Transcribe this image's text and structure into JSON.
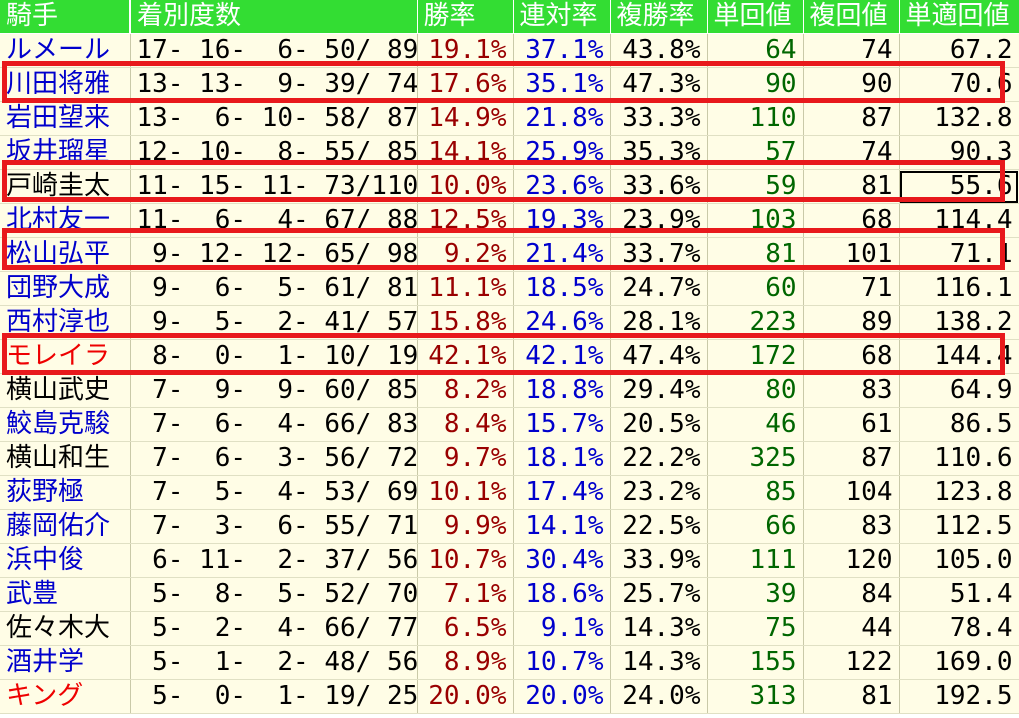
{
  "headers": [
    "騎手",
    "着別度数",
    "勝率",
    "連対率",
    "複勝率",
    "単回値",
    "複回値",
    "単適回値"
  ],
  "colors": {
    "header_bg": "#33dd33",
    "row_bg": "#fffde6",
    "name_blue": "#0000cc",
    "name_red": "#ee0000",
    "name_black": "#000000",
    "win_rate": "#990000",
    "place_rate": "#0000cc",
    "tan_value": "#006600",
    "highlight": "#e8191c"
  },
  "rows": [
    {
      "jockey": "ルメール",
      "name_color": "blue",
      "record": "17- 16-  6- 50/ 89",
      "win": "19.1%",
      "ren": "37.1%",
      "fuku": "43.8%",
      "tan": "64",
      "fukuk": "74",
      "tanteki": "67.2"
    },
    {
      "jockey": "川田将雅",
      "name_color": "blue",
      "record": "13- 13-  9- 39/ 74",
      "win": "17.6%",
      "ren": "35.1%",
      "fuku": "47.3%",
      "tan": "90",
      "fukuk": "90",
      "tanteki": "70.6"
    },
    {
      "jockey": "岩田望来",
      "name_color": "blue",
      "record": "13-  6- 10- 58/ 87",
      "win": "14.9%",
      "ren": "21.8%",
      "fuku": "33.3%",
      "tan": "110",
      "fukuk": "87",
      "tanteki": "132.8"
    },
    {
      "jockey": "坂井瑠星",
      "name_color": "blue",
      "record": "12- 10-  8- 55/ 85",
      "win": "14.1%",
      "ren": "25.9%",
      "fuku": "35.3%",
      "tan": "57",
      "fukuk": "74",
      "tanteki": "90.3"
    },
    {
      "jockey": "戸崎圭太",
      "name_color": "black",
      "record": "11- 15- 11- 73/110",
      "win": "10.0%",
      "ren": "23.6%",
      "fuku": "33.6%",
      "tan": "59",
      "fukuk": "81",
      "tanteki": "55.6"
    },
    {
      "jockey": "北村友一",
      "name_color": "blue",
      "record": "11-  6-  4- 67/ 88",
      "win": "12.5%",
      "ren": "19.3%",
      "fuku": "23.9%",
      "tan": "103",
      "fukuk": "68",
      "tanteki": "114.4"
    },
    {
      "jockey": "松山弘平",
      "name_color": "blue",
      "record": " 9- 12- 12- 65/ 98",
      "win": "9.2%",
      "ren": "21.4%",
      "fuku": "33.7%",
      "tan": "81",
      "fukuk": "101",
      "tanteki": "71.1"
    },
    {
      "jockey": "団野大成",
      "name_color": "blue",
      "record": " 9-  6-  5- 61/ 81",
      "win": "11.1%",
      "ren": "18.5%",
      "fuku": "24.7%",
      "tan": "60",
      "fukuk": "71",
      "tanteki": "116.1"
    },
    {
      "jockey": "西村淳也",
      "name_color": "blue",
      "record": " 9-  5-  2- 41/ 57",
      "win": "15.8%",
      "ren": "24.6%",
      "fuku": "28.1%",
      "tan": "223",
      "fukuk": "89",
      "tanteki": "138.2"
    },
    {
      "jockey": "モレイラ",
      "name_color": "red",
      "record": " 8-  0-  1- 10/ 19",
      "win": "42.1%",
      "ren": "42.1%",
      "fuku": "47.4%",
      "tan": "172",
      "fukuk": "68",
      "tanteki": "144.4"
    },
    {
      "jockey": "横山武史",
      "name_color": "black",
      "record": " 7-  9-  9- 60/ 85",
      "win": "8.2%",
      "ren": "18.8%",
      "fuku": "29.4%",
      "tan": "80",
      "fukuk": "83",
      "tanteki": "64.9"
    },
    {
      "jockey": "鮫島克駿",
      "name_color": "blue",
      "record": " 7-  6-  4- 66/ 83",
      "win": "8.4%",
      "ren": "15.7%",
      "fuku": "20.5%",
      "tan": "46",
      "fukuk": "61",
      "tanteki": "86.5"
    },
    {
      "jockey": "横山和生",
      "name_color": "black",
      "record": " 7-  6-  3- 56/ 72",
      "win": "9.7%",
      "ren": "18.1%",
      "fuku": "22.2%",
      "tan": "325",
      "fukuk": "87",
      "tanteki": "110.6"
    },
    {
      "jockey": "荻野極",
      "name_color": "blue",
      "record": " 7-  5-  4- 53/ 69",
      "win": "10.1%",
      "ren": "17.4%",
      "fuku": "23.2%",
      "tan": "85",
      "fukuk": "104",
      "tanteki": "123.8"
    },
    {
      "jockey": "藤岡佑介",
      "name_color": "blue",
      "record": " 7-  3-  6- 55/ 71",
      "win": "9.9%",
      "ren": "14.1%",
      "fuku": "22.5%",
      "tan": "66",
      "fukuk": "83",
      "tanteki": "112.5"
    },
    {
      "jockey": "浜中俊",
      "name_color": "blue",
      "record": " 6- 11-  2- 37/ 56",
      "win": "10.7%",
      "ren": "30.4%",
      "fuku": "33.9%",
      "tan": "111",
      "fukuk": "120",
      "tanteki": "105.0"
    },
    {
      "jockey": "武豊",
      "name_color": "blue",
      "record": " 5-  8-  5- 52/ 70",
      "win": "7.1%",
      "ren": "18.6%",
      "fuku": "25.7%",
      "tan": "39",
      "fukuk": "84",
      "tanteki": "51.4"
    },
    {
      "jockey": "佐々木大",
      "name_color": "black",
      "record": " 5-  2-  4- 66/ 77",
      "win": "6.5%",
      "ren": "9.1%",
      "fuku": "14.3%",
      "tan": "75",
      "fukuk": "44",
      "tanteki": "78.4"
    },
    {
      "jockey": "酒井学",
      "name_color": "blue",
      "record": " 5-  1-  2- 48/ 56",
      "win": "8.9%",
      "ren": "10.7%",
      "fuku": "14.3%",
      "tan": "155",
      "fukuk": "122",
      "tanteki": "169.0"
    },
    {
      "jockey": "キング",
      "name_color": "red",
      "record": " 5-  0-  1- 19/ 25",
      "win": "20.0%",
      "ren": "20.0%",
      "fuku": "24.0%",
      "tan": "313",
      "fukuk": "81",
      "tanteki": "192.5"
    }
  ]
}
